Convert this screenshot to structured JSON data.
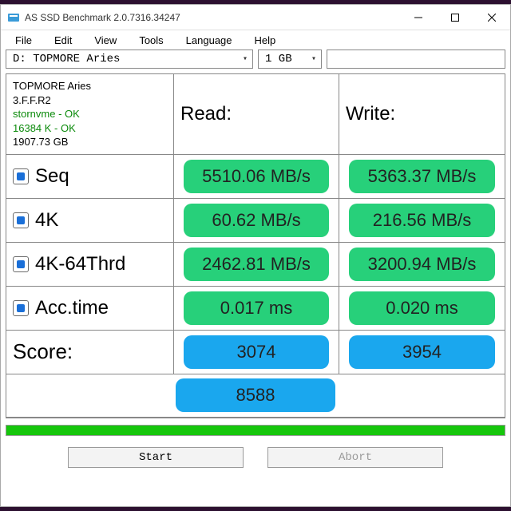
{
  "window": {
    "title": "AS SSD Benchmark 2.0.7316.34247"
  },
  "menu": {
    "file": "File",
    "edit": "Edit",
    "view": "View",
    "tools": "Tools",
    "language": "Language",
    "help": "Help"
  },
  "selectors": {
    "drive": "D: TOPMORE Aries",
    "size": "1 GB"
  },
  "info": {
    "model": "TOPMORE Aries",
    "firmware": "3.F.F.R2",
    "driver": "stornvme - OK",
    "alignment": "16384 K - OK",
    "capacity": "1907.73 GB"
  },
  "headers": {
    "read": "Read:",
    "write": "Write:"
  },
  "tests": {
    "seq": {
      "label": "Seq",
      "checked": true,
      "read": "5510.06 MB/s",
      "write": "5363.37 MB/s"
    },
    "fourk": {
      "label": "4K",
      "checked": true,
      "read": "60.62 MB/s",
      "write": "216.56 MB/s"
    },
    "thrd": {
      "label": "4K-64Thrd",
      "checked": true,
      "read": "2462.81 MB/s",
      "write": "3200.94 MB/s"
    },
    "acc": {
      "label": "Acc.time",
      "checked": true,
      "read": "0.017 ms",
      "write": "0.020 ms"
    }
  },
  "score": {
    "label": "Score:",
    "read": "3074",
    "write": "3954",
    "total": "8588"
  },
  "buttons": {
    "start": "Start",
    "abort": "Abort"
  }
}
